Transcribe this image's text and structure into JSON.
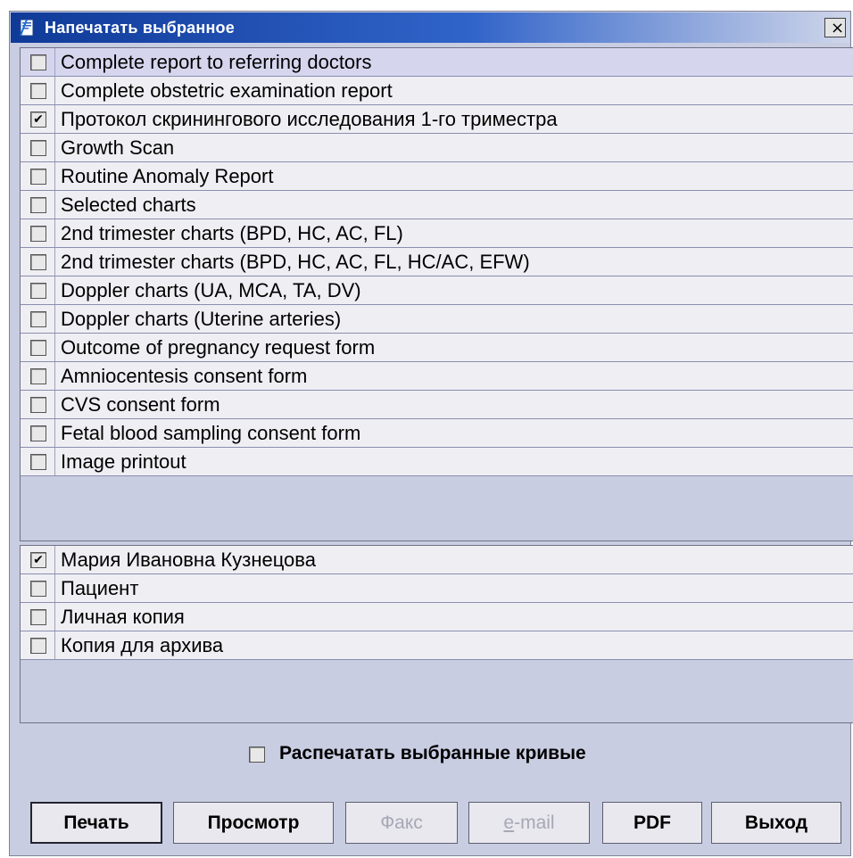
{
  "window": {
    "title": "Напечатать выбранное",
    "close_label": "×",
    "icon": "print-document-icon"
  },
  "reports": [
    {
      "label": "Complete report to referring doctors",
      "checked": false,
      "selected": true
    },
    {
      "label": "Complete obstetric examination report",
      "checked": false
    },
    {
      "label": "Протокол скринингового исследования 1-го триместра",
      "checked": true
    },
    {
      "label": "Growth Scan",
      "checked": false
    },
    {
      "label": "Routine Anomaly Report",
      "checked": false
    },
    {
      "label": "Selected charts",
      "checked": false
    },
    {
      "label": "2nd trimester charts (BPD, HC, AC, FL)",
      "checked": false
    },
    {
      "label": "2nd trimester charts (BPD, HC, AC, FL, HC/AC, EFW)",
      "checked": false
    },
    {
      "label": "Doppler charts (UA, MCA, TA, DV)",
      "checked": false
    },
    {
      "label": "Doppler charts (Uterine arteries)",
      "checked": false
    },
    {
      "label": "Outcome of pregnancy request form",
      "checked": false
    },
    {
      "label": "Amniocentesis consent form",
      "checked": false
    },
    {
      "label": "CVS consent form",
      "checked": false
    },
    {
      "label": "Fetal blood sampling consent form",
      "checked": false
    },
    {
      "label": "Image printout",
      "checked": false
    }
  ],
  "recipients": [
    {
      "label": "Мария Ивановна Кузнецова",
      "checked": true
    },
    {
      "label": "Пациент",
      "checked": false
    },
    {
      "label": "Личная копия",
      "checked": false
    },
    {
      "label": "Копия для архива",
      "checked": false
    }
  ],
  "print_curves": {
    "label": "Распечатать выбранные кривые",
    "checked": false
  },
  "buttons": {
    "print": "Печать",
    "preview": "Просмотр",
    "fax": "Факс",
    "email_prefix": "e",
    "email_rest": "-mail",
    "pdf": "PDF",
    "exit": "Выход"
  },
  "check_glyph": "✔",
  "colors": {
    "dialog_bg": "#c9cde2",
    "row_bg": "#efeff3",
    "selected_row_bg": "#d5d6ee",
    "title_gradient_start": "#0f3a98",
    "title_gradient_end": "#cfd6ea",
    "disabled_text": "#a7a8b5"
  }
}
